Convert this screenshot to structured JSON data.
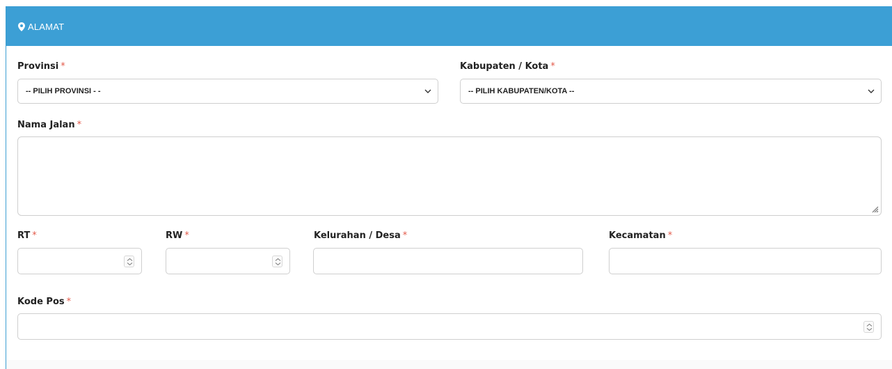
{
  "section": {
    "title": "ALAMAT",
    "icon": "map-marker-icon",
    "header_color": "#3c9fd5"
  },
  "required_mark": "*",
  "fields": {
    "provinsi": {
      "label": "Provinsi",
      "value": "-- PILIH PROVINSI - -"
    },
    "kabupaten": {
      "label": "Kabupaten / Kota",
      "value": "-- PILIH KABUPATEN/KOTA --"
    },
    "nama_jalan": {
      "label": "Nama Jalan",
      "value": ""
    },
    "rt": {
      "label": "RT",
      "value": ""
    },
    "rw": {
      "label": "RW",
      "value": ""
    },
    "kelurahan": {
      "label": "Kelurahan / Desa",
      "value": ""
    },
    "kecamatan": {
      "label": "Kecamatan",
      "value": ""
    },
    "kode_pos": {
      "label": "Kode Pos",
      "value": ""
    }
  }
}
